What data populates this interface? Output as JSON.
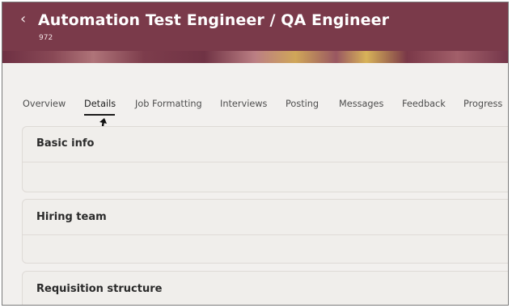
{
  "header": {
    "back_icon": "chevron-left-icon",
    "title": "Automation Test Engineer / QA Engineer",
    "requisition_number": "972",
    "accent_color": "#7a3a4a"
  },
  "tabs": [
    {
      "label": "Overview",
      "active": false
    },
    {
      "label": "Details",
      "active": true
    },
    {
      "label": "Job Formatting",
      "active": false
    },
    {
      "label": "Interviews",
      "active": false
    },
    {
      "label": "Posting",
      "active": false
    },
    {
      "label": "Messages",
      "active": false
    },
    {
      "label": "Feedback",
      "active": false
    },
    {
      "label": "Progress",
      "active": false
    }
  ],
  "sections": [
    {
      "title": "Basic info"
    },
    {
      "title": "Hiring team"
    },
    {
      "title": "Requisition structure"
    }
  ]
}
